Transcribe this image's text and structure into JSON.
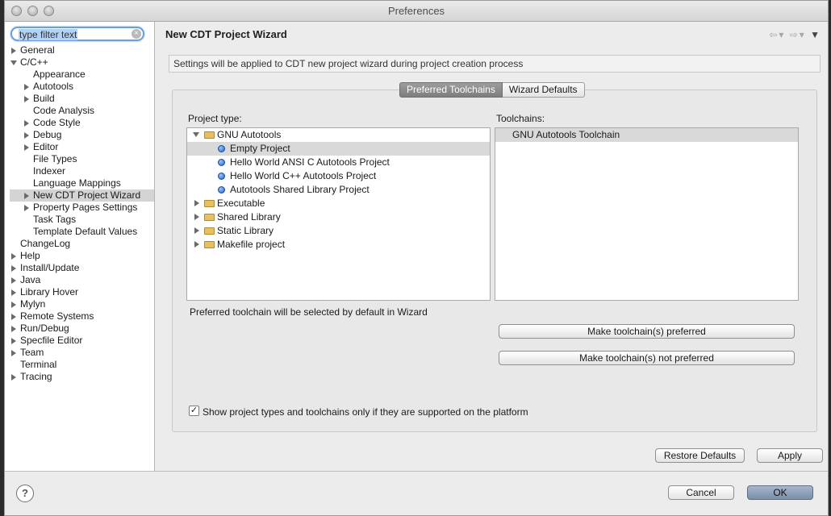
{
  "window": {
    "title": "Preferences"
  },
  "filter": {
    "placeholder": "type filter text"
  },
  "tree": [
    {
      "label": "General",
      "indent": 0,
      "arrow": "right"
    },
    {
      "label": "C/C++",
      "indent": 0,
      "arrow": "down"
    },
    {
      "label": "Appearance",
      "indent": 1,
      "arrow": "none"
    },
    {
      "label": "Autotools",
      "indent": 1,
      "arrow": "right"
    },
    {
      "label": "Build",
      "indent": 1,
      "arrow": "right"
    },
    {
      "label": "Code Analysis",
      "indent": 1,
      "arrow": "none"
    },
    {
      "label": "Code Style",
      "indent": 1,
      "arrow": "right"
    },
    {
      "label": "Debug",
      "indent": 1,
      "arrow": "right"
    },
    {
      "label": "Editor",
      "indent": 1,
      "arrow": "right"
    },
    {
      "label": "File Types",
      "indent": 1,
      "arrow": "none"
    },
    {
      "label": "Indexer",
      "indent": 1,
      "arrow": "none"
    },
    {
      "label": "Language Mappings",
      "indent": 1,
      "arrow": "none"
    },
    {
      "label": "New CDT Project Wizard",
      "indent": 1,
      "arrow": "right",
      "selected": true
    },
    {
      "label": "Property Pages Settings",
      "indent": 1,
      "arrow": "right"
    },
    {
      "label": "Task Tags",
      "indent": 1,
      "arrow": "none"
    },
    {
      "label": "Template Default Values",
      "indent": 1,
      "arrow": "none"
    },
    {
      "label": "ChangeLog",
      "indent": 0,
      "arrow": "none"
    },
    {
      "label": "Help",
      "indent": 0,
      "arrow": "right"
    },
    {
      "label": "Install/Update",
      "indent": 0,
      "arrow": "right"
    },
    {
      "label": "Java",
      "indent": 0,
      "arrow": "right"
    },
    {
      "label": "Library Hover",
      "indent": 0,
      "arrow": "right"
    },
    {
      "label": "Mylyn",
      "indent": 0,
      "arrow": "right"
    },
    {
      "label": "Remote Systems",
      "indent": 0,
      "arrow": "right"
    },
    {
      "label": "Run/Debug",
      "indent": 0,
      "arrow": "right"
    },
    {
      "label": "Specfile Editor",
      "indent": 0,
      "arrow": "right"
    },
    {
      "label": "Team",
      "indent": 0,
      "arrow": "right"
    },
    {
      "label": "Terminal",
      "indent": 0,
      "arrow": "none"
    },
    {
      "label": "Tracing",
      "indent": 0,
      "arrow": "right"
    }
  ],
  "main": {
    "title": "New CDT Project Wizard",
    "description": "Settings will be applied to CDT new project wizard during project creation process",
    "tabs": [
      "Preferred Toolchains",
      "Wizard Defaults"
    ],
    "project_type_label": "Project type:",
    "toolchains_label": "Toolchains:",
    "project_types": [
      {
        "label": "GNU Autotools",
        "kind": "folder",
        "arrow": "down",
        "level": 0
      },
      {
        "label": "Empty Project",
        "kind": "item",
        "level": 1,
        "selected": true
      },
      {
        "label": "Hello World ANSI C Autotools Project",
        "kind": "item",
        "level": 1
      },
      {
        "label": "Hello World C++ Autotools Project",
        "kind": "item",
        "level": 1
      },
      {
        "label": "Autotools Shared Library Project",
        "kind": "item",
        "level": 1
      },
      {
        "label": "Executable",
        "kind": "folder",
        "arrow": "right",
        "level": 0
      },
      {
        "label": "Shared Library",
        "kind": "folder",
        "arrow": "right",
        "level": 0
      },
      {
        "label": "Static Library",
        "kind": "folder",
        "arrow": "right",
        "level": 0
      },
      {
        "label": "Makefile project",
        "kind": "folder",
        "arrow": "right",
        "level": 0
      }
    ],
    "toolchains": [
      "GNU Autotools Toolchain"
    ],
    "preferred_note": "Preferred toolchain will be selected by default in Wizard",
    "make_preferred": "Make toolchain(s) preferred",
    "make_not_preferred": "Make toolchain(s) not preferred",
    "checkbox_label": "Show project types and toolchains only if they are supported on the platform",
    "checkbox_checked": true,
    "restore_defaults": "Restore Defaults",
    "apply": "Apply"
  },
  "footer": {
    "help_glyph": "?",
    "cancel": "Cancel",
    "ok": "OK"
  }
}
